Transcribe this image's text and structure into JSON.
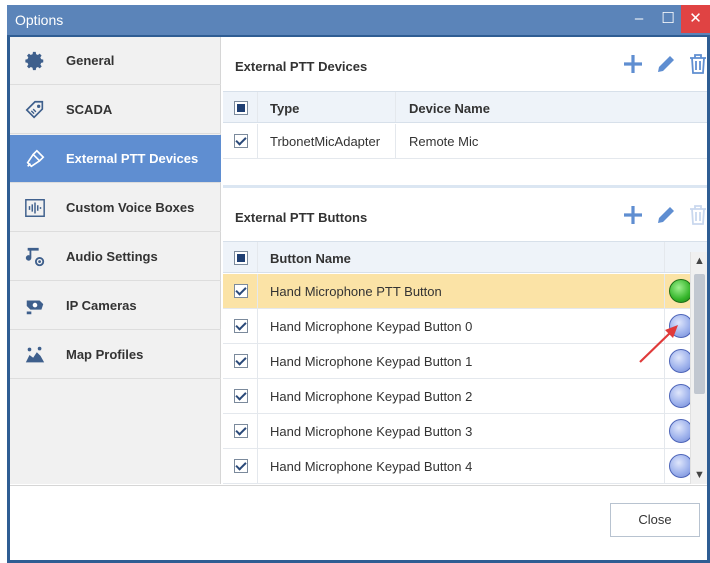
{
  "window": {
    "title": "Options",
    "controls": {
      "minimize": "–",
      "maximize": "☐",
      "close": "✕"
    },
    "colors": {
      "titlebar": "#5b84b9",
      "accent": "#5f8ed1",
      "close": "#e04343"
    }
  },
  "sidebar": {
    "items": [
      {
        "label": "General",
        "icon": "gear-icon",
        "active": false
      },
      {
        "label": "SCADA",
        "icon": "tag-icon",
        "active": false
      },
      {
        "label": "External PTT Devices",
        "icon": "microphone-icon",
        "active": true
      },
      {
        "label": "Custom Voice Boxes",
        "icon": "audio-waveform-icon",
        "active": false
      },
      {
        "label": "Audio Settings",
        "icon": "audio-settings-icon",
        "active": false
      },
      {
        "label": "IP Cameras",
        "icon": "camera-icon",
        "active": false
      },
      {
        "label": "Map Profiles",
        "icon": "map-icon",
        "active": false
      }
    ]
  },
  "devices_panel": {
    "title": "External PTT Devices",
    "columns": [
      "Type",
      "Device Name"
    ],
    "rows": [
      {
        "checked": true,
        "type": "TrbonetMicAdapter",
        "device_name": "Remote Mic"
      }
    ]
  },
  "buttons_panel": {
    "title": "External PTT Buttons",
    "columns": [
      "Button Name"
    ],
    "rows": [
      {
        "checked": true,
        "name": "Hand Microphone PTT Button",
        "state": "green",
        "selected": true
      },
      {
        "checked": true,
        "name": "Hand Microphone Keypad Button 0",
        "state": "blue",
        "selected": false
      },
      {
        "checked": true,
        "name": "Hand Microphone Keypad Button 1",
        "state": "blue",
        "selected": false
      },
      {
        "checked": true,
        "name": "Hand Microphone Keypad Button 2",
        "state": "blue",
        "selected": false
      },
      {
        "checked": true,
        "name": "Hand Microphone Keypad Button 3",
        "state": "blue",
        "selected": false
      },
      {
        "checked": true,
        "name": "Hand Microphone Keypad Button 4",
        "state": "blue",
        "selected": false
      }
    ]
  },
  "footer": {
    "close_label": "Close"
  }
}
